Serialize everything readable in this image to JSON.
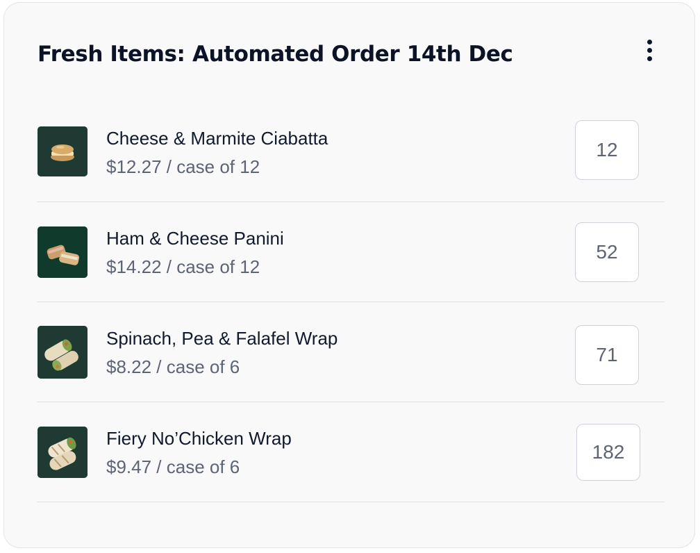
{
  "card": {
    "title": "Fresh Items: Automated Order 14th Dec",
    "menu_icon": "more-vertical-icon"
  },
  "items": [
    {
      "name": "Cheese & Marmite Ciabatta",
      "price": "$12.27 / case of 12",
      "quantity": "12",
      "thumbnail_icon": "ciabatta-sandwich-image"
    },
    {
      "name": "Ham & Cheese Panini",
      "price": "$14.22 / case of 12",
      "quantity": "52",
      "thumbnail_icon": "panini-sandwich-image"
    },
    {
      "name": "Spinach, Pea & Falafel Wrap",
      "price": "$8.22 / case of 6",
      "quantity": "71",
      "thumbnail_icon": "falafel-wrap-image"
    },
    {
      "name": "Fiery No’Chicken Wrap",
      "price": "$9.47 / case of 6",
      "quantity": "182",
      "thumbnail_icon": "chicken-wrap-image"
    }
  ],
  "colors": {
    "card_background": "#f9f9fa",
    "title_text": "#0c1326",
    "secondary_text": "#5d6474",
    "thumbnail_background": "#1e3a32"
  }
}
